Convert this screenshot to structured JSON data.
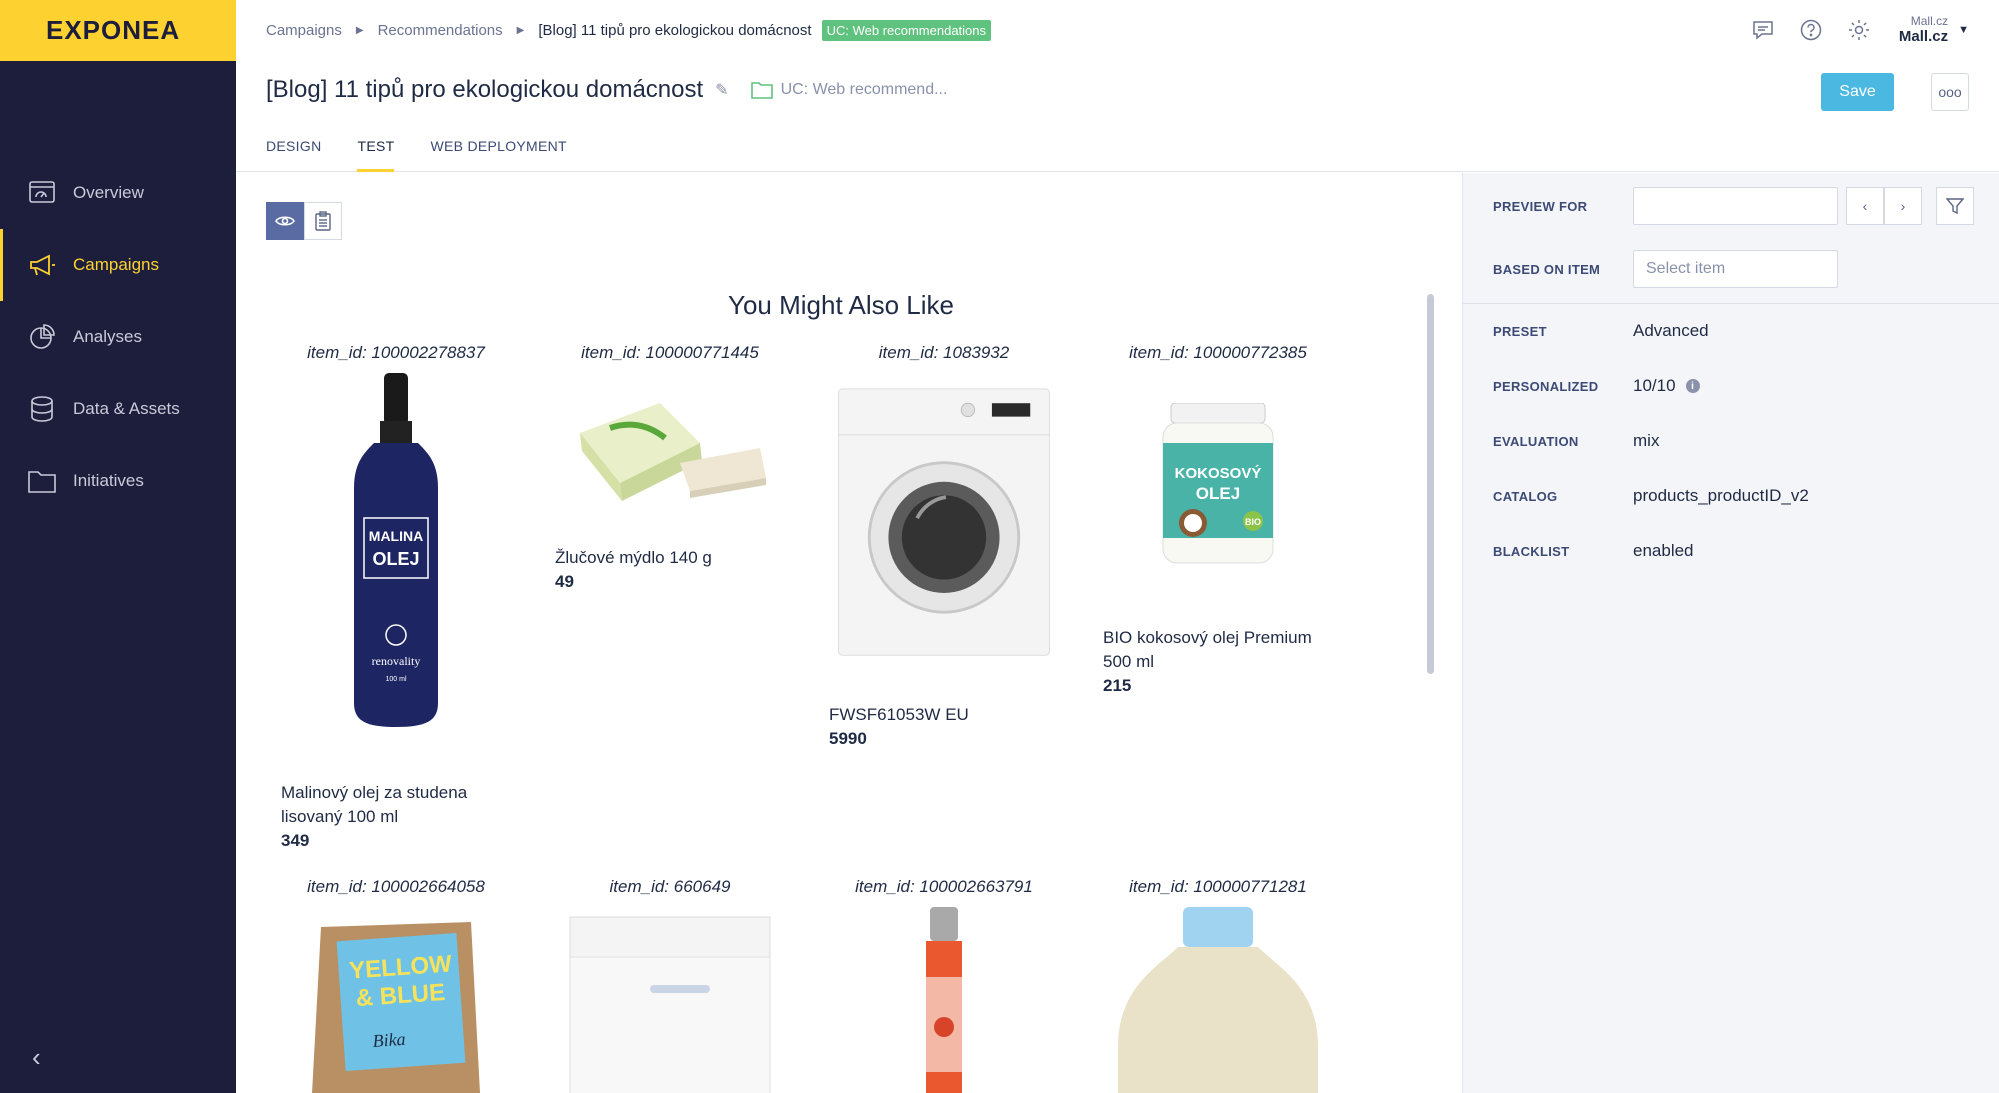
{
  "app": {
    "logo": "EXPONEA"
  },
  "sidebar": {
    "items": [
      {
        "label": "Overview",
        "icon": "overview-icon"
      },
      {
        "label": "Campaigns",
        "icon": "megaphone-icon",
        "active": true
      },
      {
        "label": "Analyses",
        "icon": "pie-chart-icon"
      },
      {
        "label": "Data & Assets",
        "icon": "database-icon"
      },
      {
        "label": "Initiatives",
        "icon": "folder-icon"
      }
    ],
    "collapse": "‹"
  },
  "breadcrumb": {
    "items": [
      "Campaigns",
      "Recommendations",
      "[Blog] 11 tipů pro ekologickou domácnost"
    ],
    "badge": "UC: Web recommendations"
  },
  "header": {
    "title": "[Blog] 11 tipů pro ekologickou domácnost",
    "folder": "UC: Web recommend...",
    "tabs": [
      "DESIGN",
      "TEST",
      "WEB DEPLOYMENT"
    ],
    "active_tab": "TEST",
    "save_label": "Save",
    "more_label": "ooo",
    "account_small": "Mall.cz",
    "account_big": "Mall.cz"
  },
  "preview": {
    "heading": "You Might Also Like",
    "products": [
      {
        "item_id": "item_id: 100002278837",
        "name": "Malinový olej za studena lisovaný 100 ml",
        "price": "349",
        "img": "bottle"
      },
      {
        "item_id": "item_id: 100000771445",
        "name": "Žlučové mýdlo 140 g",
        "price": "49",
        "img": "soap"
      },
      {
        "item_id": "item_id: 1083932",
        "name": "FWSF61053W EU",
        "price": "5990",
        "img": "washer"
      },
      {
        "item_id": "item_id: 100000772385",
        "name": "BIO kokosový olej Premium 500 ml",
        "price": "215",
        "img": "jar"
      },
      {
        "item_id": "item_id: 100002664058",
        "name": "",
        "price": "",
        "img": "bag"
      },
      {
        "item_id": "item_id: 660649",
        "name": "",
        "price": "",
        "img": "toploader"
      },
      {
        "item_id": "item_id: 100002663791",
        "name": "",
        "price": "",
        "img": "smallbottle"
      },
      {
        "item_id": "item_id: 100000771281",
        "name": "",
        "price": "",
        "img": "jug"
      }
    ],
    "img_text": {
      "bottle_line1": "MALINA",
      "bottle_line2": "OLEJ",
      "bottle_brand": "renovality",
      "bottle_volume": "100 ml",
      "jar_line1": "KOKOSOVÝ",
      "jar_line2": "OLEJ",
      "jar_bio": "BIO",
      "bag_line1": "YELLOW",
      "bag_line2": "& BLUE",
      "bag_line3": "Bika"
    }
  },
  "panel": {
    "preview_for_label": "PREVIEW FOR",
    "preview_for_value": "",
    "based_on_label": "BASED ON ITEM",
    "based_on_placeholder": "Select item",
    "rows": [
      {
        "label": "PRESET",
        "value": "Advanced"
      },
      {
        "label": "PERSONALIZED",
        "value": "10/10"
      },
      {
        "label": "EVALUATION",
        "value": "mix"
      },
      {
        "label": "CATALOG",
        "value": "products_productID_v2"
      },
      {
        "label": "BLACKLIST",
        "value": "enabled"
      }
    ]
  },
  "colors": {
    "sidebar_bg": "#1d1e3c",
    "brand_yellow": "#fdd12f",
    "save_blue": "#4ab8e0",
    "badge_green": "#5fc27e"
  }
}
